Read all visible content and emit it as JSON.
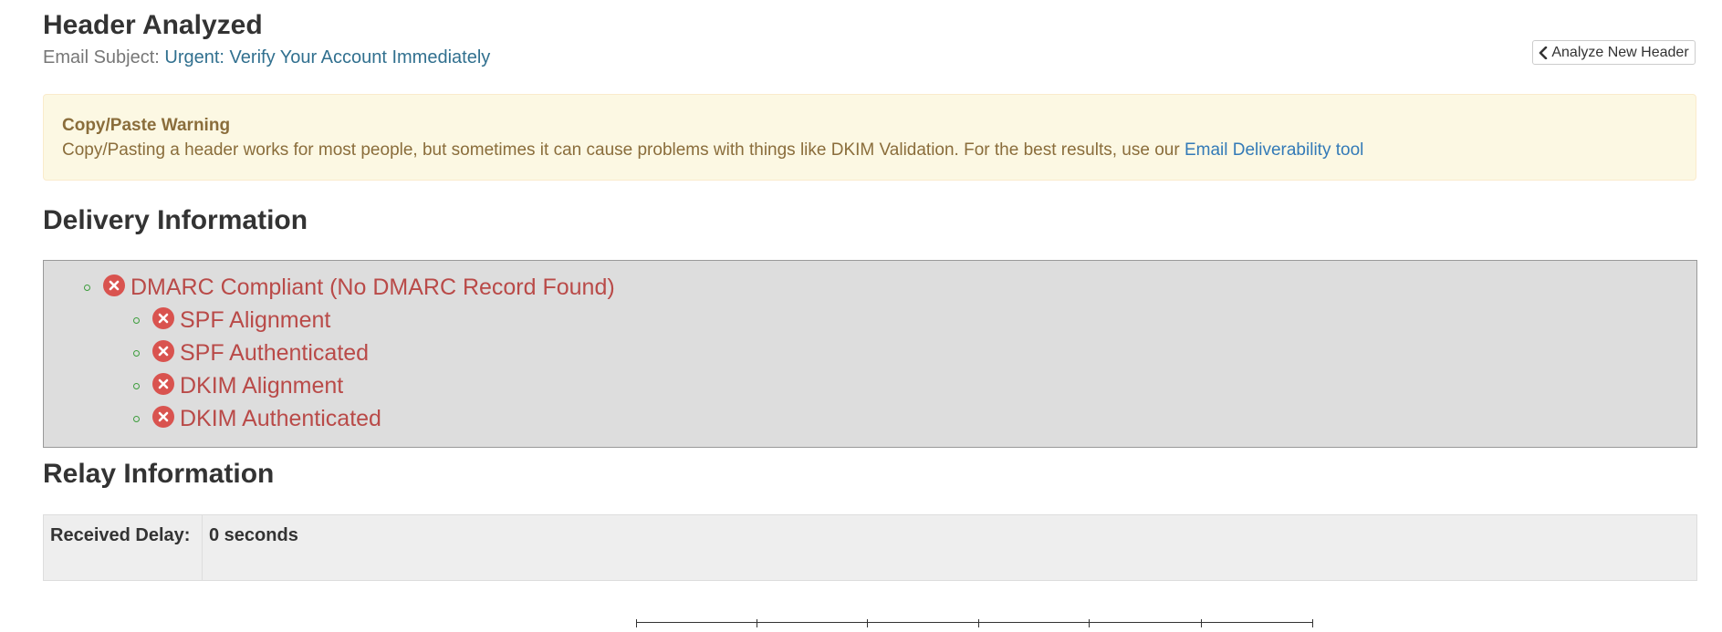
{
  "header": {
    "title": "Header Analyzed",
    "subject_label": "Email Subject:",
    "subject_value": "Urgent: Verify Your Account Immediately",
    "analyze_button_label": "Analyze New Header",
    "analyze_button_icon": "chevron-left-icon"
  },
  "warning": {
    "title": "Copy/Paste Warning",
    "body": "Copy/Pasting a header works for most people, but sometimes it can cause problems with things like DKIM Validation. For the best results, use our",
    "link_text": "Email Deliverability tool"
  },
  "delivery": {
    "title": "Delivery Information",
    "status_icon": "x-circle-icon",
    "fail_color": "#b94a48",
    "bullet_color": "#3c9d3c",
    "items": [
      {
        "label": "DMARC Compliant (No DMARC Record Found)",
        "status": "fail"
      },
      {
        "label": "SPF Alignment",
        "status": "fail"
      },
      {
        "label": "SPF Authenticated",
        "status": "fail"
      },
      {
        "label": "DKIM Alignment",
        "status": "fail"
      },
      {
        "label": "DKIM Authenticated",
        "status": "fail"
      }
    ]
  },
  "relay": {
    "title": "Relay Information",
    "received_delay_label": "Received Delay:",
    "received_delay_value": "0 seconds"
  },
  "colors": {
    "link": "#337ab7",
    "subject": "#31708f",
    "warning_bg": "#fcf8e3",
    "warning_text": "#8a6d3b",
    "delivery_bg": "#dddddd"
  }
}
